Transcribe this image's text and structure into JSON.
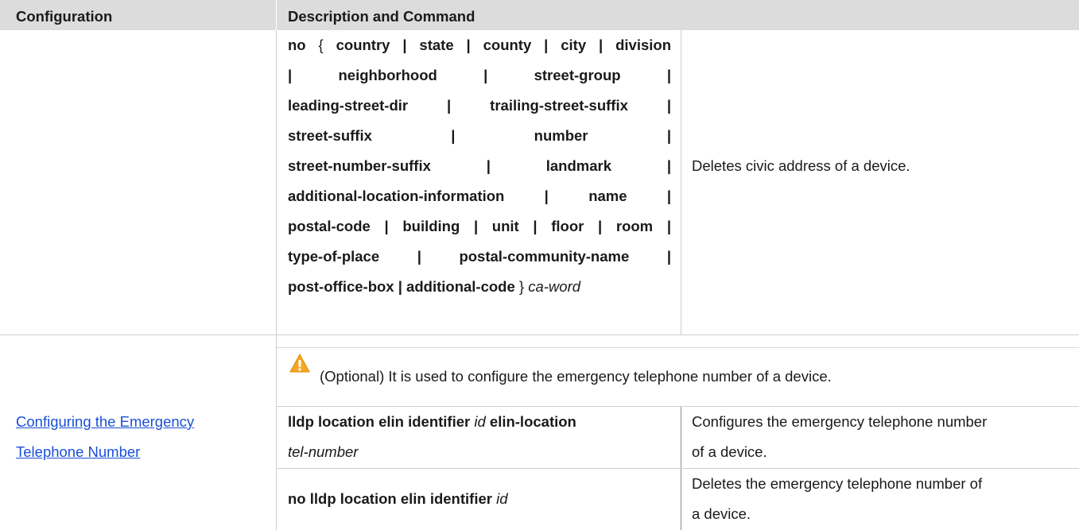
{
  "table": {
    "headers": {
      "configuration": "Configuration",
      "description": "Description and Command"
    },
    "row1": {
      "command_lines": [
        [
          "no",
          " { ",
          "country | state | county | city | division"
        ],
        [
          "|",
          "neighborhood",
          "|",
          "street-group",
          "|"
        ],
        [
          "leading-street-dir",
          "|",
          "trailing-street-suffix",
          "|"
        ],
        [
          "street-suffix",
          "|",
          "number",
          "|"
        ],
        [
          "street-number-suffix",
          "|",
          "landmark",
          "|"
        ],
        [
          "additional-location-information",
          "|",
          "name",
          "|"
        ],
        [
          "postal-code | building | unit | floor | room |"
        ],
        [
          "type-of-place |",
          "postal-community-name |"
        ],
        [
          "post-office-box | additional-code",
          " } ",
          "ca-word"
        ]
      ],
      "description": "Deletes civic address of a device."
    },
    "row2": {
      "configuration_link_lines": [
        "Configuring the Emergency ",
        "Telephone Number"
      ],
      "note": "(Optional) It is used to configure the emergency telephone number of a device.",
      "note_icon": "warning-triangle-icon",
      "commands": [
        {
          "parts": [
            "lldp location elin identifier",
            " id ",
            "elin-location"
          ],
          "line2": "tel-number",
          "description_lines": [
            "Configures the emergency telephone number",
            "of a device."
          ]
        },
        {
          "parts": [
            "no lldp location elin identifier",
            " id"
          ],
          "description_lines": [
            "Deletes the emergency telephone number of",
            "a device."
          ]
        }
      ]
    }
  },
  "colors": {
    "header_bg": "#dcdcdc",
    "link": "#1a4fd6",
    "warning": "#f5a623"
  }
}
